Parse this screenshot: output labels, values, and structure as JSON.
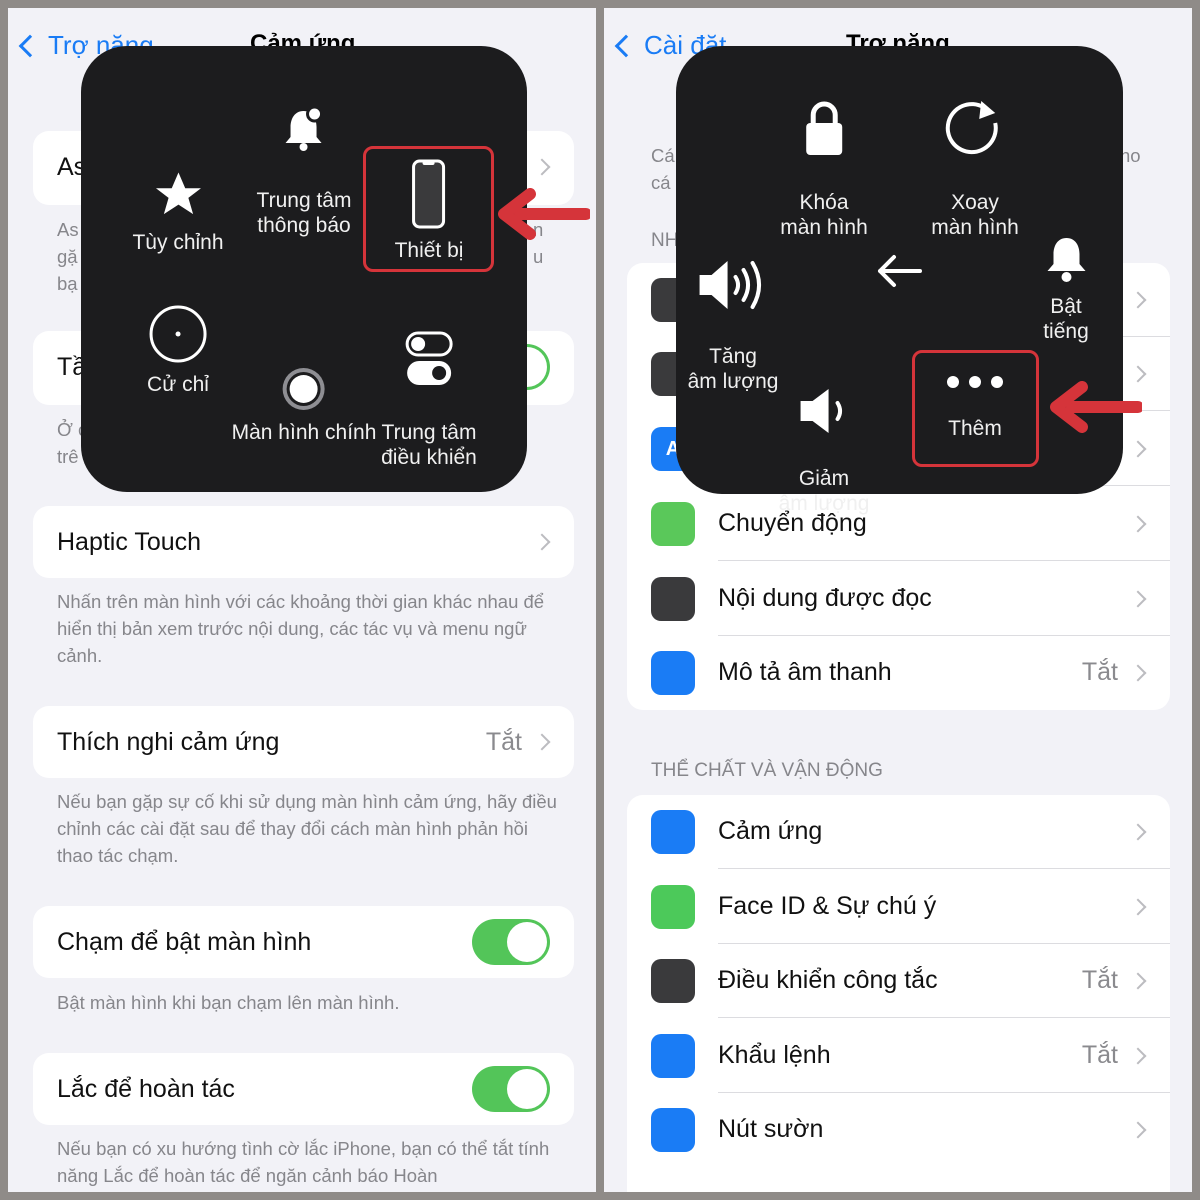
{
  "left": {
    "back": "Trợ năng",
    "title": "Cảm ứng",
    "fragments": {
      "row1": "As",
      "desc1": [
        "As",
        "gặ",
        "bạ"
      ],
      "row2": "Tầ",
      "desc2": [
        "Ở c",
        "trê"
      ],
      "desc1_right": [
        "n",
        "u"
      ]
    },
    "haptic": {
      "label": "Haptic Touch",
      "desc": "Nhấn trên màn hình với các khoảng thời gian khác nhau để hiển thị bản xem trước nội dung, các tác vụ và menu ngữ cảnh."
    },
    "adapt": {
      "label": "Thích nghi cảm ứng",
      "value": "Tắt",
      "desc": "Nếu bạn gặp sự cố khi sử dụng màn hình cảm ứng, hãy điều chỉnh các cài đặt sau để thay đổi cách màn hình phản hồi thao tác chạm."
    },
    "tap_wake": {
      "label": "Chạm để bật màn hình",
      "on": true,
      "desc": "Bật màn hình khi bạn chạm lên màn hình."
    },
    "shake": {
      "label": "Lắc để hoàn tác",
      "on": true,
      "desc": "Nếu bạn có xu hướng tình cờ lắc iPhone, bạn có thể tắt tính năng Lắc để hoàn tác để ngăn cảnh báo Hoàn"
    },
    "menu": {
      "notification": "Trung tâm\nthông báo",
      "custom": "Tùy chỉnh",
      "device": "Thiết bị",
      "gestures": "Cử chỉ",
      "home": "Màn hình chính",
      "control": "Trung tâm\nđiều khiển"
    }
  },
  "right": {
    "back": "Cài đặt",
    "title": "Trợ năng",
    "fragments": {
      "desc": [
        "Cá",
        "cá"
      ],
      "desc_right": "ho",
      "section": "NH"
    },
    "menu": {
      "lock": "Khóa\nmàn hình",
      "rotate": "Xoay\nmàn hình",
      "vol_up": "Tăng\nâm lượng",
      "unmute": "Bật tiếng",
      "vol_down": "Giảm\nâm lượng",
      "more": "Thêm"
    },
    "vision_rows": [
      {
        "label": "Chuyển động",
        "icon": "motion-icon",
        "color": "#5ac85a"
      },
      {
        "label": "Nội dung được đọc",
        "icon": "speech-icon",
        "color": "#3a3a3c"
      },
      {
        "label": "Mô tả âm thanh",
        "value": "Tắt",
        "icon": "audio-description-icon",
        "color": "#1a7cf5"
      }
    ],
    "section2": "THỂ CHẤT VÀ VẬN ĐỘNG",
    "physical_rows": [
      {
        "label": "Cảm ứng",
        "icon": "touch-icon",
        "color": "#1a7cf5"
      },
      {
        "label": "Face ID & Sự chú ý",
        "icon": "face-id-icon",
        "color": "#4cc95a"
      },
      {
        "label": "Điều khiển công tắc",
        "value": "Tắt",
        "icon": "switch-control-icon",
        "color": "#3a3a3c"
      },
      {
        "label": "Khẩu lệnh",
        "value": "Tắt",
        "icon": "voice-control-icon",
        "color": "#1a7cf5"
      },
      {
        "label": "Nút sườn",
        "icon": "side-button-icon",
        "color": "#1a7cf5"
      }
    ]
  },
  "colors": {
    "highlight": "#d5343a",
    "toggle_on": "#53c559",
    "accent": "#1a7cf5"
  }
}
